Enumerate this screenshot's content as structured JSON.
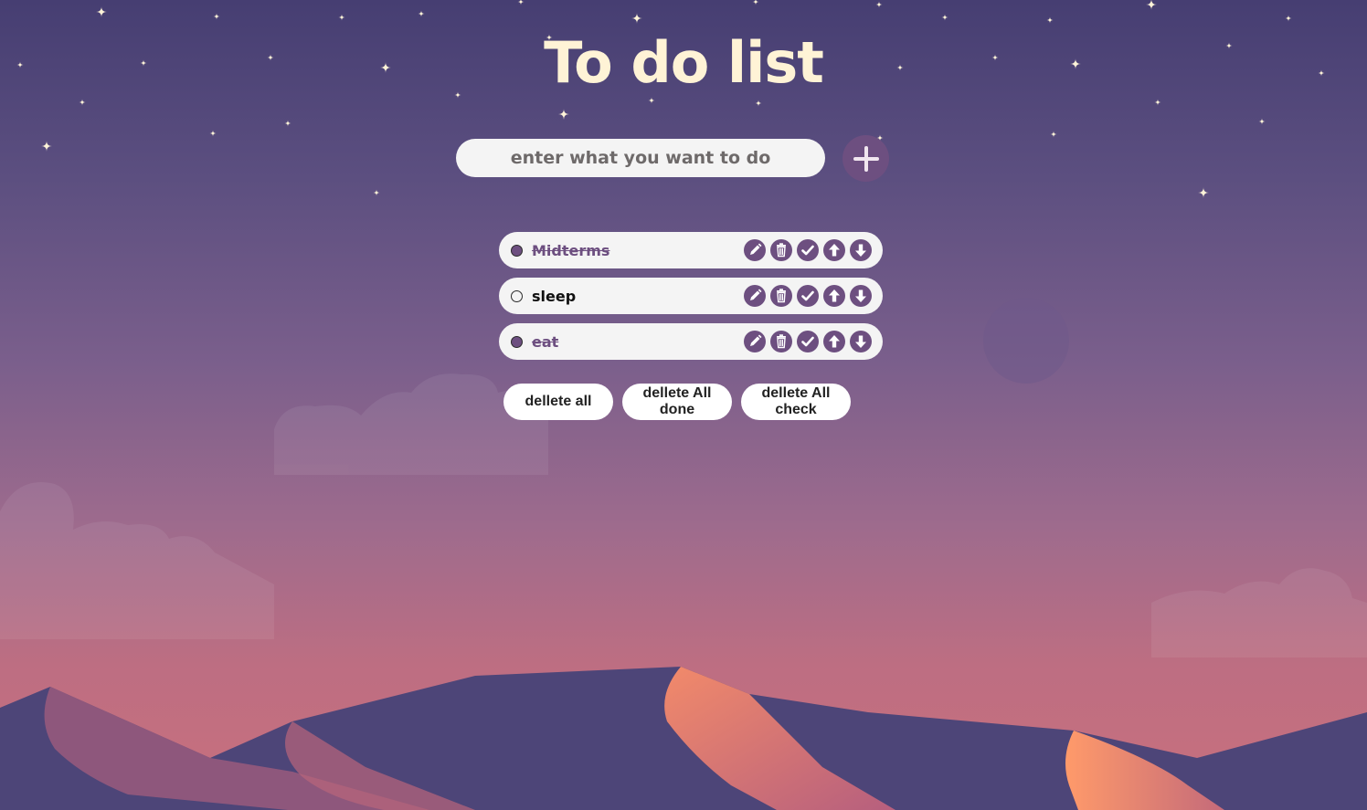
{
  "header": {
    "title": "To do list"
  },
  "entry": {
    "placeholder": "enter what you want to do",
    "add_icon": "plus-icon"
  },
  "tasks": [
    {
      "label": "Midterms",
      "done": true
    },
    {
      "label": "sleep",
      "done": false
    },
    {
      "label": "eat",
      "done": true
    }
  ],
  "task_actions": [
    "pencil-icon",
    "trash-icon",
    "check-icon",
    "arrow-up-icon",
    "arrow-down-icon"
  ],
  "footer": {
    "delete_all": "dellete all",
    "delete_all_done": "dellete All done",
    "delete_all_check": "dellete All check"
  },
  "colors": {
    "accent": "#6d4f80",
    "title": "#fff3d6",
    "task_bg": "#f4f4f4",
    "done_text": "#6d4f80",
    "pending_text": "#111111",
    "input_text": "#6e6a6a",
    "moon": "#f3e6c2"
  }
}
